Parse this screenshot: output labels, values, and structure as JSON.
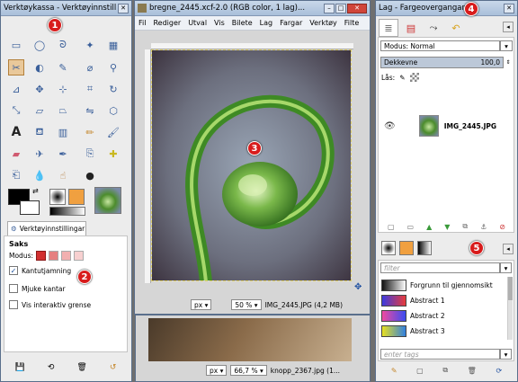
{
  "toolbox": {
    "title": "Verktøykassa - Verktøyinnstill...",
    "marker": "1",
    "tool_options_tab": "Verktøyinnstillingar",
    "tool_name": "Saks",
    "mode_label": "Modus:",
    "options": [
      {
        "label": "Kantutjamning",
        "checked": true
      },
      {
        "label": "Mjuke kantar",
        "checked": false
      },
      {
        "label": "Vis interaktiv grense",
        "checked": false
      }
    ],
    "marker2": "2"
  },
  "image_window": {
    "title": "bregne_2445.xcf-2.0 (RGB color, 1 lag)...",
    "menu": [
      "Fil",
      "Rediger",
      "Utval",
      "Vis",
      "Bilete",
      "Lag",
      "Fargar",
      "Verktøy",
      "Filte"
    ],
    "marker": "3",
    "unit": "px",
    "zoom": "50 %",
    "status": "IMG_2445.JPG (4,2 MB)"
  },
  "back_window": {
    "unit": "px",
    "zoom": "66,7 %",
    "status": "knopp_2367.jpg (1..."
  },
  "layers_panel": {
    "title": "Lag - Fargeovergangar",
    "marker": "4",
    "mode_label": "Modus: Normal",
    "opacity_label": "Dekkevne",
    "opacity_value": "100,0",
    "lock_label": "Lås:",
    "layer_name": "IMG_2445.JPG"
  },
  "gradients_panel": {
    "marker": "5",
    "filter_placeholder": "filter",
    "items": [
      {
        "name": "Forgrunn til gjennomsikt",
        "colors": [
          "#111111",
          "#ffffff"
        ]
      },
      {
        "name": "Abstract 1",
        "colors": [
          "#3b3be0",
          "#e83b3b"
        ]
      },
      {
        "name": "Abstract 2",
        "colors": [
          "#f04aa0",
          "#3a4cf0"
        ]
      },
      {
        "name": "Abstract 3",
        "colors": [
          "#e8e020",
          "#3080e0"
        ]
      }
    ],
    "tags_placeholder": "enter tags"
  },
  "colors": {
    "foreground": "#000000",
    "background": "#ffffff",
    "accent": "#d81c1c",
    "selection": "#e9c89a"
  }
}
